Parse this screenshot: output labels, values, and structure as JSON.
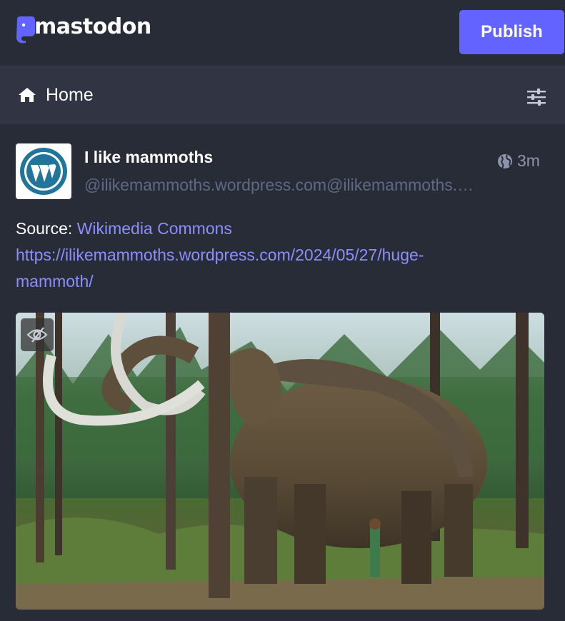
{
  "brand": {
    "name": "mastodon"
  },
  "toolbar": {
    "publish_label": "Publish"
  },
  "column": {
    "title": "Home"
  },
  "status": {
    "display_name": "I like mammoths",
    "handle": "@ilikemammoths.wordpress.com@ilikemammoths.wordpress.com",
    "relative_time": "3m",
    "visibility_icon": "globe-icon",
    "source_prefix": "Source: ",
    "source_link": "Wikimedia Commons",
    "url_line1": "https://ilikemammoths.wordpress.com/2024/05/27/huge-",
    "url_line2": "mammoth/",
    "media_kind": "photo"
  },
  "colors": {
    "background": "#282c37",
    "header": "#313543",
    "accent": "#6364ff",
    "link": "#8c8dff",
    "muted": "#606984",
    "wordpress_blue": "#21759b"
  }
}
